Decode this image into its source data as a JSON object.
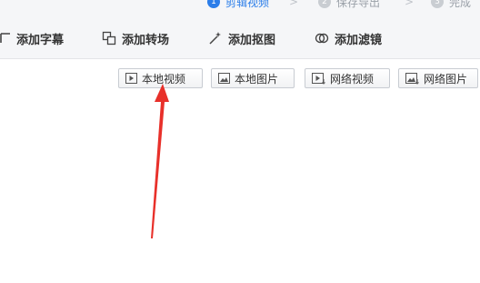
{
  "steps": [
    {
      "label": "剪辑视频",
      "number": "1",
      "active": true
    },
    {
      "label": "保存导出",
      "number": "2",
      "active": false
    },
    {
      "label": "完成",
      "number": "3",
      "active": false
    }
  ],
  "step_separator": ">",
  "toolbar": {
    "add_subtitle": "添加字幕",
    "add_transition": "添加转场",
    "add_cutout": "添加抠图",
    "add_filter": "添加滤镜"
  },
  "sources": {
    "local_video": "本地视频",
    "local_image": "本地图片",
    "online_video": "网络视频",
    "online_image": "网络图片"
  },
  "colors": {
    "accent": "#2b7de9",
    "annotation_arrow": "#e8302a"
  }
}
